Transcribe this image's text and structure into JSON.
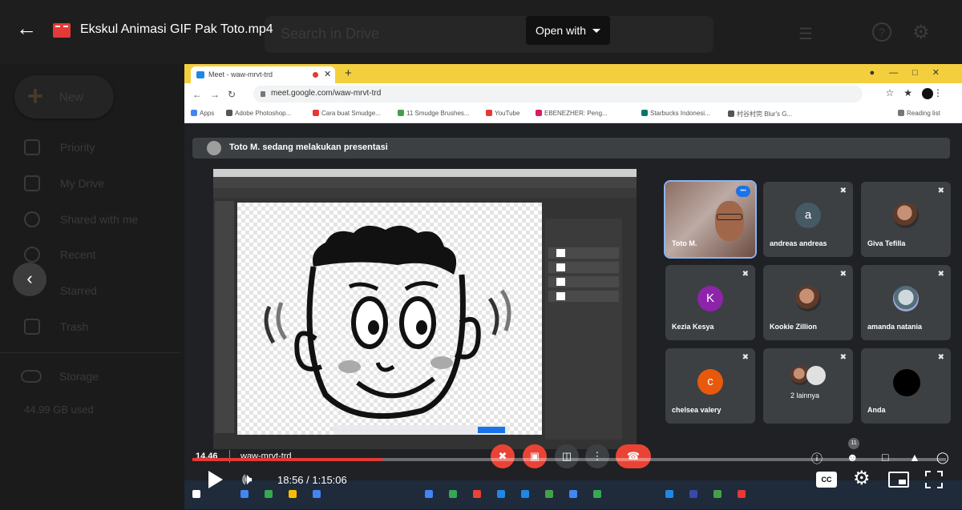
{
  "drive": {
    "search_placeholder": "Search in Drive",
    "new_label": "New",
    "nav": [
      "Priority",
      "My Drive",
      "Shared with me",
      "Recent",
      "Starred",
      "Trash"
    ],
    "storage_label": "Storage",
    "storage_used": "44.99 GB used"
  },
  "viewer": {
    "file_name": "Ekskul Animasi GIF Pak Toto.mp4",
    "open_with_label": "Open with"
  },
  "browser": {
    "tab_title": "Meet - waw-mrvt-trd",
    "url": "meet.google.com/waw-mrvt-trd",
    "bookmarks": [
      "Apps",
      "Adobe Photoshop...",
      "Cara buat Smudge...",
      "11 Smudge Brushes...",
      "YouTube",
      "EBENEZHER: Peng...",
      "Starbucks Indonesi...",
      "村谷村完 Blur's G...",
      "Reading list"
    ]
  },
  "meet": {
    "presenting_text": "Toto M. sedang melakukan presentasi",
    "meeting_time": "14.46",
    "meeting_code": "waw-mrvt-trd",
    "participant_count": "11",
    "participants": [
      {
        "name": "Toto M.",
        "avatar_letter": "",
        "avatar_color": "",
        "kind": "camera"
      },
      {
        "name": "andreas andreas",
        "avatar_letter": "a",
        "avatar_color": "#455a64",
        "kind": "letter"
      },
      {
        "name": "Giva Tefilla",
        "avatar_letter": "",
        "avatar_color": "",
        "kind": "photo"
      },
      {
        "name": "Kezia Kesya",
        "avatar_letter": "K",
        "avatar_color": "#8e24aa",
        "kind": "letter"
      },
      {
        "name": "Kookie Zillion",
        "avatar_letter": "",
        "avatar_color": "",
        "kind": "photo"
      },
      {
        "name": "amanda natania",
        "avatar_letter": "",
        "avatar_color": "",
        "kind": "photo"
      },
      {
        "name": "chelsea valery",
        "avatar_letter": "c",
        "avatar_color": "#e8590c",
        "kind": "letter"
      },
      {
        "name": "2 lainnya",
        "avatar_letter": "",
        "avatar_color": "",
        "kind": "photo"
      },
      {
        "name": "Anda",
        "avatar_letter": "",
        "avatar_color": "#000000",
        "kind": "dark"
      }
    ]
  },
  "player": {
    "time_display": "18:56 / 1:15:06",
    "progress": 0.252,
    "cc_label": "CC"
  },
  "colors": {
    "accent_red": "#e53935",
    "meet_red": "#ea4335",
    "speaking_blue": "#8ab4f8"
  }
}
